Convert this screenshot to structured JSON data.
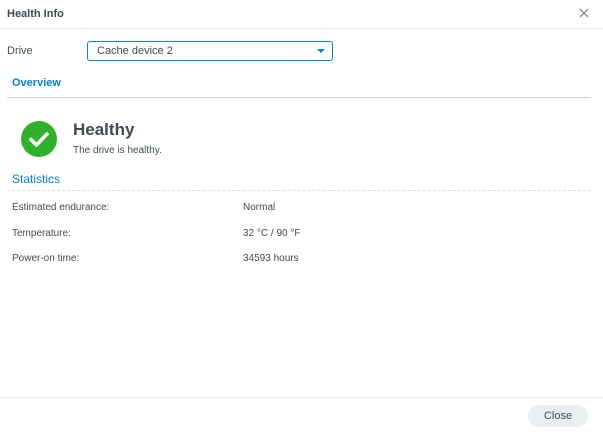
{
  "window": {
    "title": "Health Info"
  },
  "drive": {
    "label": "Drive",
    "selected": "Cache device 2"
  },
  "tabs": [
    {
      "label": "Overview",
      "active": true
    }
  ],
  "status": {
    "icon": "check-circle-icon",
    "color": "#2fb12c",
    "title": "Healthy",
    "subtitle": "The drive is healthy."
  },
  "statistics": {
    "heading": "Statistics",
    "rows": [
      {
        "label": "Estimated endurance:",
        "value": "Normal"
      },
      {
        "label": "Temperature:",
        "value": "32 °C / 90 °F"
      },
      {
        "label": "Power-on time:",
        "value": "34593 hours"
      }
    ]
  },
  "footer": {
    "close_label": "Close"
  },
  "colors": {
    "accent": "#057fe0",
    "success": "#2fb12c",
    "text": "#414b55"
  }
}
